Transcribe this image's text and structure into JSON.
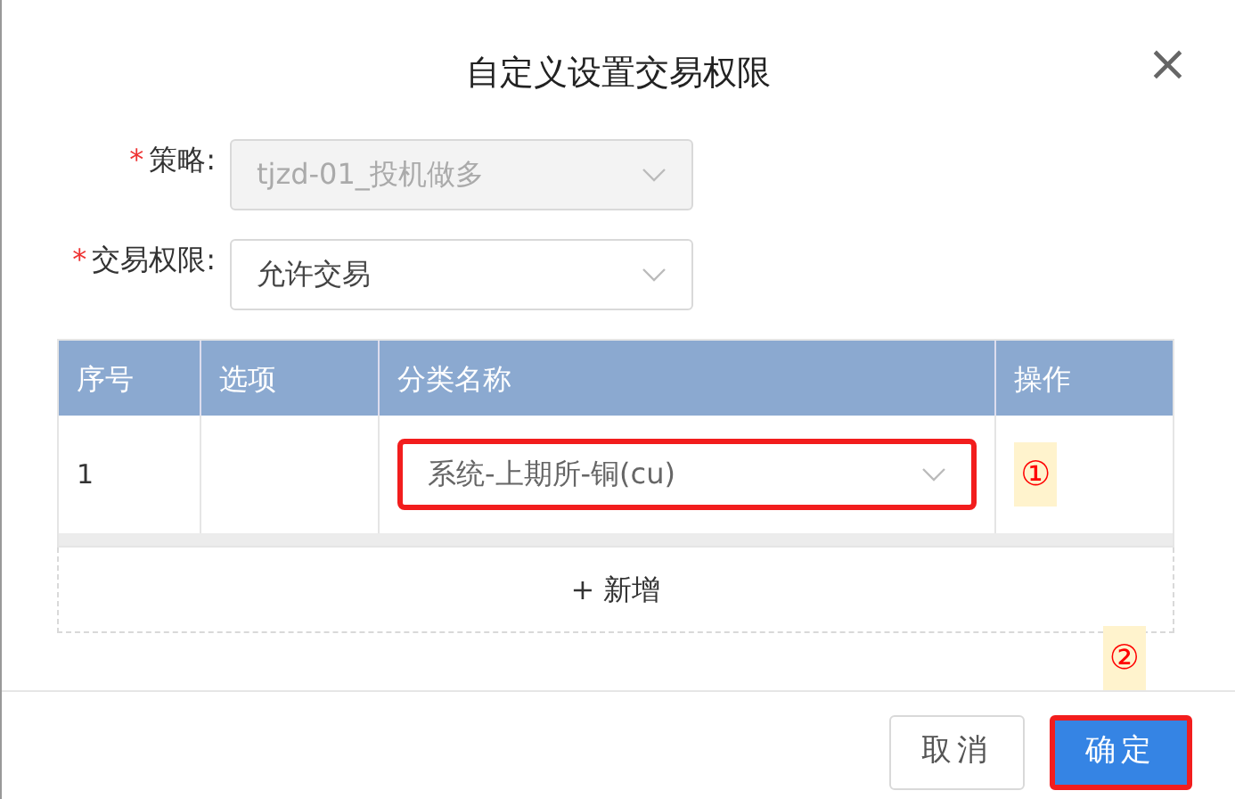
{
  "dialog": {
    "title": "自定义设置交易权限",
    "close": "×"
  },
  "fields": [
    {
      "required_mark": "*",
      "label": "策略:",
      "value": "tjzd-01_投机做多",
      "disabled": true
    },
    {
      "required_mark": "*",
      "label": "交易权限:",
      "value": "允许交易",
      "disabled": false
    }
  ],
  "table": {
    "columns": [
      "序号",
      "选项",
      "分类名称",
      "操作"
    ],
    "rows": [
      {
        "index": "1",
        "category": {
          "value": "系统-上期所-铜(cu)",
          "highlighted": true
        },
        "action_mark": "①"
      }
    ],
    "add_button": {
      "icon": "+",
      "label": "新增"
    }
  },
  "footer": {
    "marker": "②",
    "buttons": [
      {
        "label": "取消",
        "kind": "secondary",
        "highlighted": false
      },
      {
        "label": "确定",
        "kind": "primary",
        "highlighted": true
      }
    ]
  }
}
